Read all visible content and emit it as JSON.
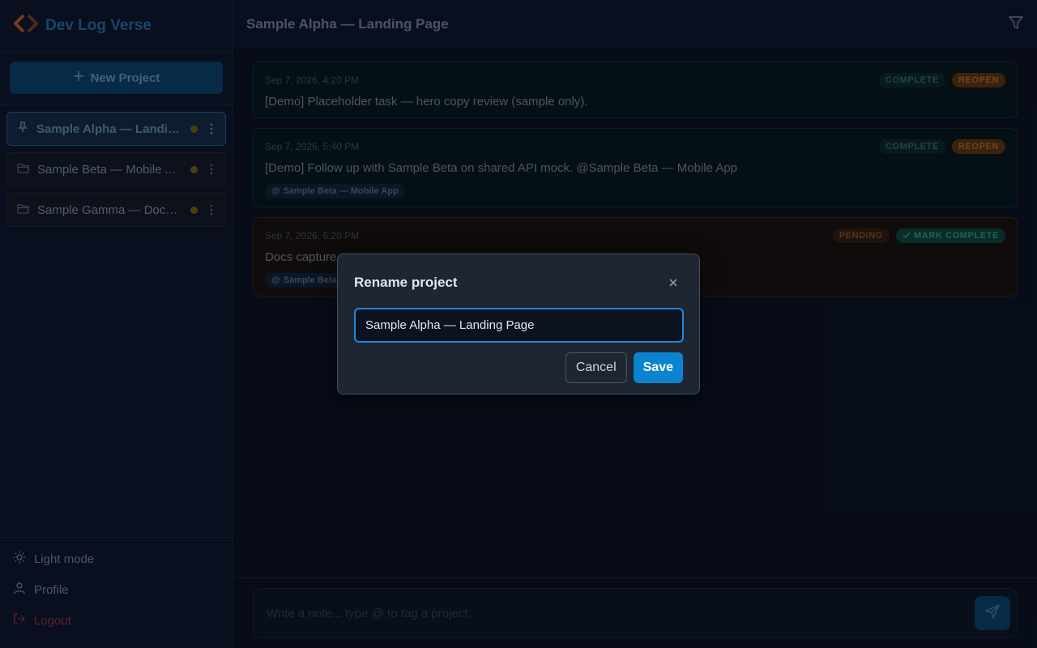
{
  "app": {
    "title": "Dev Log Verse",
    "logo_icon": "chevron-pair-logo",
    "accent_color": "#2b7bb4",
    "logo_color": "#d9662b"
  },
  "sidebar": {
    "new_project_label": "New Project",
    "projects": [
      {
        "label": "Sample Alpha — Landing Page",
        "icon": "pin-icon",
        "active": true
      },
      {
        "label": "Sample Beta — Mobile App",
        "icon": "folder-icon",
        "active": false
      },
      {
        "label": "Sample Gamma — Docs Site",
        "icon": "folder-icon",
        "active": false
      }
    ],
    "light_mode_label": "Light mode",
    "profile_label": "Profile",
    "logout_label": "Logout"
  },
  "header": {
    "title": "Sample Alpha — Landing Page",
    "filter_icon": "filter-icon"
  },
  "notes": [
    {
      "time": "Sep 7, 2026, 4:20 PM",
      "status": "COMPLETE",
      "action": "REOPEN",
      "text": "[Demo] Placeholder task — hero copy review (sample only).",
      "tag": ""
    },
    {
      "time": "Sep 7, 2026, 5:40 PM",
      "status": "COMPLETE",
      "action": "REOPEN",
      "text": "[Demo] Follow up with Sample Beta on shared API mock. @Sample Beta — Mobile App",
      "tag": "Sample Beta — Mobile App"
    },
    {
      "time": "Sep 7, 2026, 6:20 PM",
      "status": "PENDING",
      "action": "MARK COMPLETE",
      "text": "Docs capture",
      "tag": "Sample Beta"
    }
  ],
  "composer": {
    "placeholder": "Write a note... type @ to tag a project"
  },
  "modal": {
    "title": "Rename project",
    "input_value": "Sample Alpha — Landing Page",
    "cancel_label": "Cancel",
    "save_label": "Save"
  }
}
